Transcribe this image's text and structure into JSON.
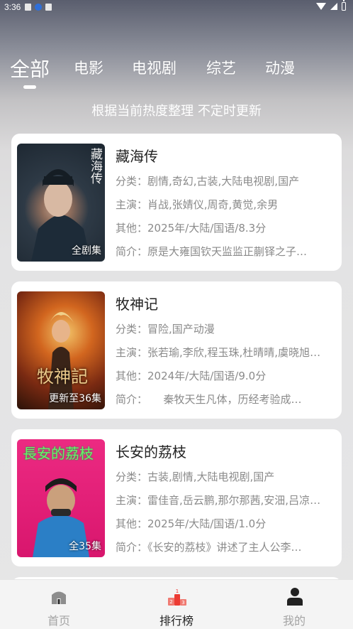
{
  "status_bar": {
    "time": "3:36"
  },
  "tabs": [
    {
      "label": "全部",
      "active": true
    },
    {
      "label": "电影",
      "active": false
    },
    {
      "label": "电视剧",
      "active": false
    },
    {
      "label": "综艺",
      "active": false
    },
    {
      "label": "动漫",
      "active": false
    }
  ],
  "subtitle": "根据当前热度整理 不定时更新",
  "items": [
    {
      "title": "藏海传",
      "badge": "全剧集",
      "category": "分类：剧情,奇幻,古装,大陆电视剧,国产",
      "cast": "主演：肖战,张婧仪,周奇,黄觉,余男",
      "other": "其他：2025年/大陆/国语/8.3分",
      "intro": "简介：原是大雍国钦天监监正蒯铎之子…",
      "poster_text": "藏海传",
      "poster_colors": [
        "#3b4a58",
        "#1f2a36",
        "#6b7d8c"
      ]
    },
    {
      "title": "牧神记",
      "badge": "更新至36集",
      "category": "分类：冒险,国产动漫",
      "cast": "主演：张若瑜,李欣,程玉珠,杜晴晴,虞晓旭…",
      "other": "其他：2024年/大陆/国语/9.0分",
      "intro": "简介：　　秦牧天生凡体，历经考验成…",
      "poster_text": "牧神記",
      "poster_colors": [
        "#c24a1c",
        "#6a2810",
        "#f0a040"
      ]
    },
    {
      "title": "长安的荔枝",
      "badge": "全35集",
      "category": "分类：古装,剧情,大陆电视剧,国产",
      "cast": "主演：雷佳音,岳云鹏,那尔那茜,安沺,吕凉…",
      "other": "其他：2025年/大陆/国语/1.0分",
      "intro": "简介：《长安的荔枝》讲述了主人公李…",
      "poster_text": "長安的荔枝",
      "poster_colors": [
        "#e8237a",
        "#c81565",
        "#2a7fc4"
      ]
    }
  ],
  "bottom_nav": [
    {
      "label": "首页",
      "icon": "home-icon",
      "active": false
    },
    {
      "label": "排行榜",
      "icon": "ranking-podium-icon",
      "active": true
    },
    {
      "label": "我的",
      "icon": "user-icon",
      "active": false
    }
  ],
  "colors": {
    "accent_red": "#e8352b",
    "card_bg": "#ffffff",
    "muted_text": "#8a8a8a"
  }
}
